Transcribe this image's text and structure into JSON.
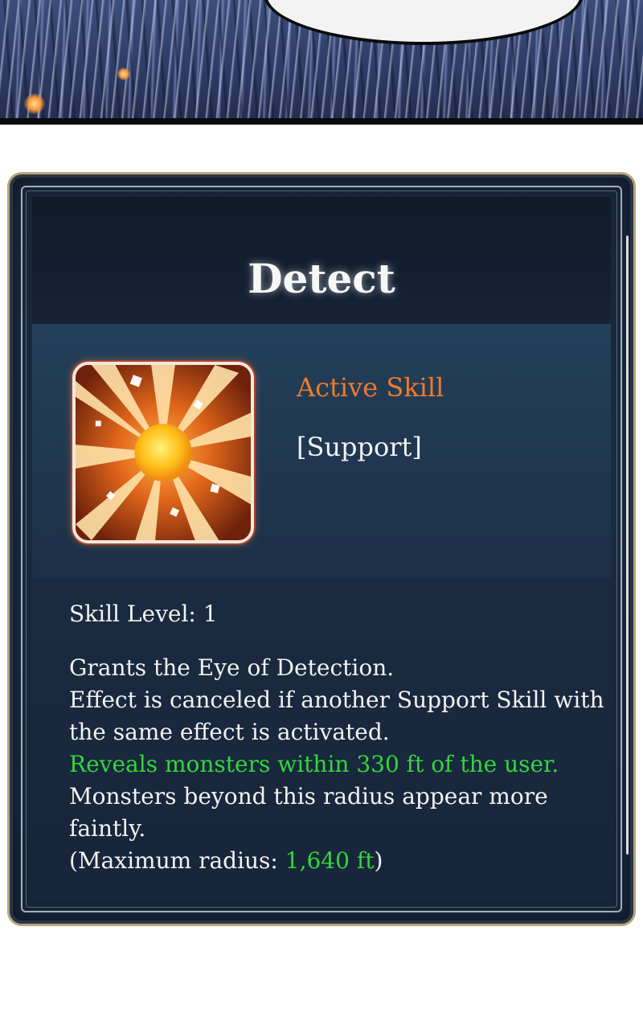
{
  "skill": {
    "name": "Detect",
    "type": "Active Skill",
    "category": "[Support]",
    "level_label": "Skill Level: 1",
    "icon": "sunburst-orb-icon",
    "description": {
      "line1": "Grants the Eye of Detection.",
      "line2": "Effect is canceled if another Support Skill with",
      "line3": "the same effect is activated.",
      "line4": "Reveals monsters within 330 ft of the user.",
      "line5": "Monsters beyond this radius appear more",
      "line6": "faintly.",
      "line7_prefix": "(Maximum radius: ",
      "line7_value": "1,640 ft",
      "line7_suffix": ")"
    }
  },
  "colors": {
    "title": "#f7f7f7",
    "type": "#f07a2a",
    "highlight": "#33d63a",
    "frame_gold": "#b8a47a",
    "panel_bg": "#18263a"
  }
}
